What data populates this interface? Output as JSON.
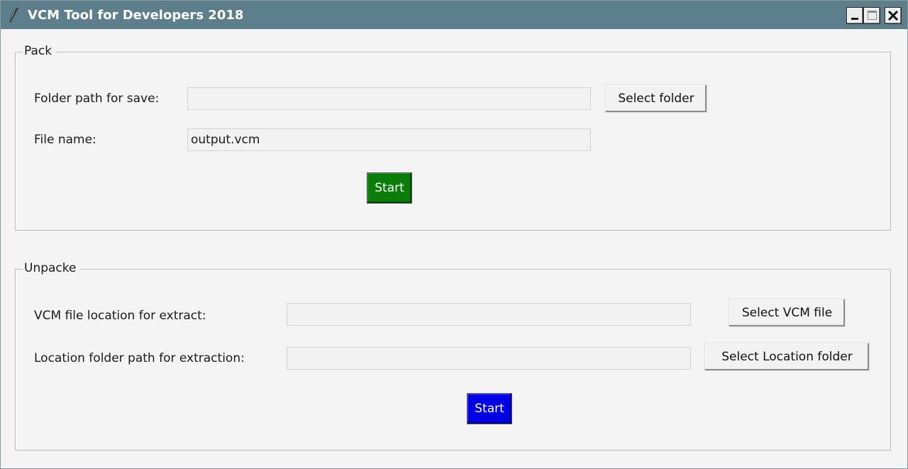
{
  "window": {
    "title": "VCM Tool for Developers 2018",
    "titlebar_color": "#5d7e8b",
    "icon": "feather-icon",
    "controls": [
      "minimize-icon",
      "maximize-icon",
      "close-icon"
    ]
  },
  "pack": {
    "legend": "Pack",
    "folder_label": "Folder path for save:",
    "folder_value": "",
    "select_folder_button": "Select folder",
    "file_label": "File name:",
    "file_value": "output.vcm",
    "start_button": "Start",
    "start_color": "#0a7d0a"
  },
  "unpack": {
    "legend": "Unpacke",
    "vcm_label": "VCM file location for extract:",
    "vcm_value": "",
    "select_vcm_button": "Select VCM file",
    "location_label": "Location folder path for extraction:",
    "location_value": "",
    "select_location_button": "Select Location folder",
    "start_button": "Start",
    "start_color": "#0000e6"
  }
}
